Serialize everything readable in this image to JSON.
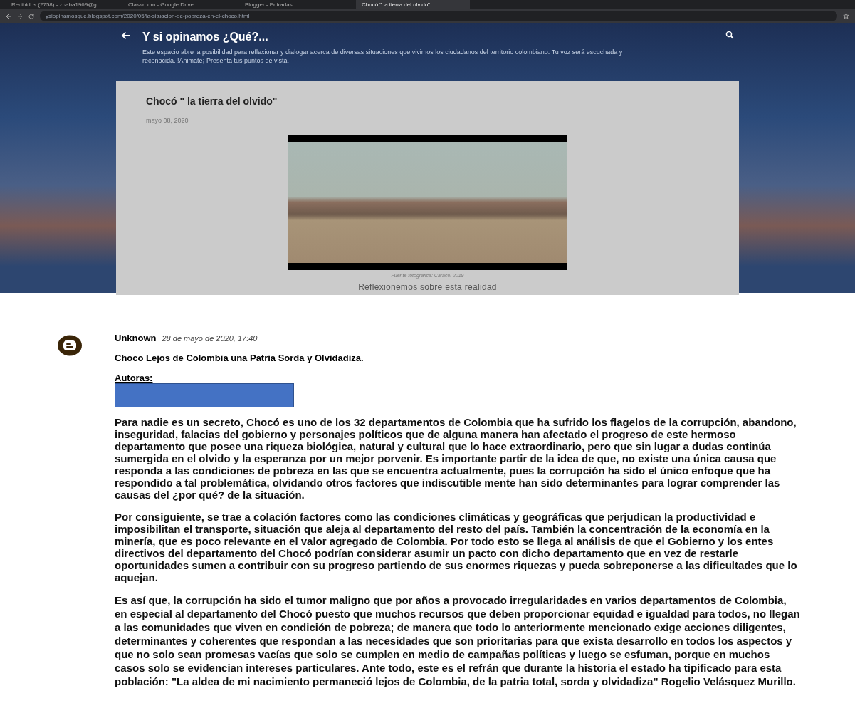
{
  "browser": {
    "tabs": [
      {
        "label": "Recibidos (2758) - zpaba1969@g...",
        "selected": false
      },
      {
        "label": "Classroom - Google Drive",
        "selected": false
      },
      {
        "label": "Blogger - Entradas",
        "selected": false
      },
      {
        "label": "Chocó \" la tierra del olvido\"",
        "selected": true
      }
    ],
    "address": "ysiopinamosque.blogspot.com/2020/05/la-situacion-de-pobreza-en-el-choco.html"
  },
  "blog": {
    "title": "Y si opinamos ¿Qué?...",
    "description": "Este espacio abre la posibilidad para reflexionar y dialogar acerca de diversas situaciones que vivimos los ciudadanos del territorio colombiano. Tu voz será escuchada y reconocida. !Animate¡ Presenta tus puntos de vista."
  },
  "post": {
    "title": "Chocó \" la tierra del olvido\"",
    "date": "mayo 08, 2020",
    "caption": "Fuente fotográfica: Caracol 2019",
    "subtitle": "Reflexionemos sobre esta realidad"
  },
  "comment": {
    "author": "Unknown",
    "time": "28 de mayo de 2020, 17:40",
    "heading": "Choco Lejos de Colombia una Patria Sorda y Olvidadiza.",
    "authors_label": "Autoras:",
    "paragraphs": [
      "Para nadie es un secreto, Chocó es uno de los 32 departamentos de Colombia que ha sufrido los flagelos de la corrupción, abandono, inseguridad, falacias del gobierno y personajes políticos que de alguna manera han afectado el progreso de este hermoso departamento que posee una riqueza biológica, natural y cultural que lo hace extraordinario, pero que sin lugar a dudas continúa sumergida en el olvido y la esperanza por un mejor porvenir. Es importante partir de la idea de que, no existe una única causa que responda a las condiciones de pobreza en las que se encuentra actualmente, pues la corrupción ha sido el único enfoque que ha respondido a tal problemática, olvidando otros factores que indiscutible mente han sido determinantes para lograr comprender las causas del ¿por qué? de la situación.",
      "Por consiguiente, se trae a colación factores como las condiciones climáticas y geográficas que perjudican la productividad e imposibilitan el transporte, situación que aleja al departamento del resto del país. También la concentración de la economía en la minería, que es poco relevante en el valor agregado de Colombia. Por todo esto se llega al análisis de que el Gobierno y los entes directivos del departamento del Chocó podrían considerar asumir un pacto con dicho departamento que en vez de restarle oportunidades sumen a contribuir con su progreso partiendo de sus enormes riquezas y pueda sobreponerse a las dificultades que lo aquejan.",
      "Es así que, la corrupción ha sido el tumor maligno que por años a provocado irregularidades en varios departamentos de Colombia, en especial al departamento del Chocó puesto que muchos recursos que deben proporcionar equidad e igualdad para todos, no llegan a las comunidades que viven en condición de pobreza; de manera que todo lo anteriormente mencionado exige acciones diligentes, determinantes y coherentes que respondan a las necesidades que son prioritarias para que exista desarrollo en todos los aspectos y que no solo sean promesas vacías que solo se cumplen en medio de campañas políticas y luego se esfuman, porque en muchos casos solo se evidencian intereses particulares. Ante todo, este es el refrán que durante la historia el estado ha tipificado para esta población: \"La aldea de mi nacimiento permaneció lejos de Colombia, de la patria total, sorda y olvidadiza\" Rogelio Velásquez Murillo."
    ]
  }
}
